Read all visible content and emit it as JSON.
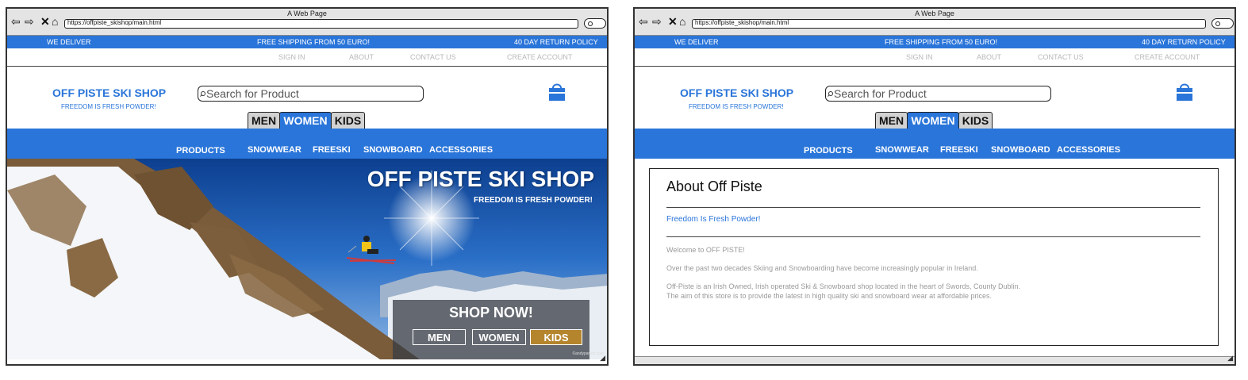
{
  "browser": {
    "title": "A Web Page",
    "url": "https://offpiste_skishop/main.html",
    "back_icon": "back-arrow-icon",
    "forward_icon": "forward-arrow-icon",
    "close_icon": "close-x-icon",
    "home_icon": "home-icon"
  },
  "topbar": {
    "left": "WE DELIVER",
    "center": "FREE SHIPPING FROM 50 EURO!",
    "right": "40 DAY RETURN POLICY",
    "color": "#2a75d9"
  },
  "account_links": [
    "SIGN IN",
    "ABOUT",
    "CONTACT US",
    "CREATE ACCOUNT"
  ],
  "brand": {
    "name": "OFF PISTE SKI SHOP",
    "tagline": "FREEDOM IS FRESH POWDER!"
  },
  "search": {
    "placeholder": "Search for Product"
  },
  "cart_icon": "shopping-bag-icon",
  "gender_tabs": [
    {
      "label": "MEN",
      "active": false
    },
    {
      "label": "WOMEN",
      "active": true
    },
    {
      "label": "KIDS",
      "active": false
    }
  ],
  "categories": [
    "PRODUCTS",
    "SNOWWEAR",
    "FREESKI",
    "SNOWBOARD",
    "ACCESSORIES"
  ],
  "hero": {
    "title": "OFF PISTE SKI SHOP",
    "subtitle": "FREEDOM IS FRESH POWDER!",
    "cta_heading": "SHOP NOW!",
    "buttons": [
      "MEN",
      "WOMEN",
      "KIDS"
    ],
    "credit": "©andyparant.com"
  },
  "about": {
    "title": "About Off Piste",
    "subtitle": "Freedom Is Fresh Powder!",
    "paragraphs": [
      "Welcome to OFF PISTE!",
      "Over the past two decades Skiing and Snowboarding have become increasingly popular in Ireland.",
      "Off-Piste is an Irish Owned, Irish operated Ski & Snowboard shop located in the heart of Swords, County Dublin.",
      "The aim of this store is to provide the latest in high quality ski and snowboard wear at affordable prices."
    ]
  }
}
